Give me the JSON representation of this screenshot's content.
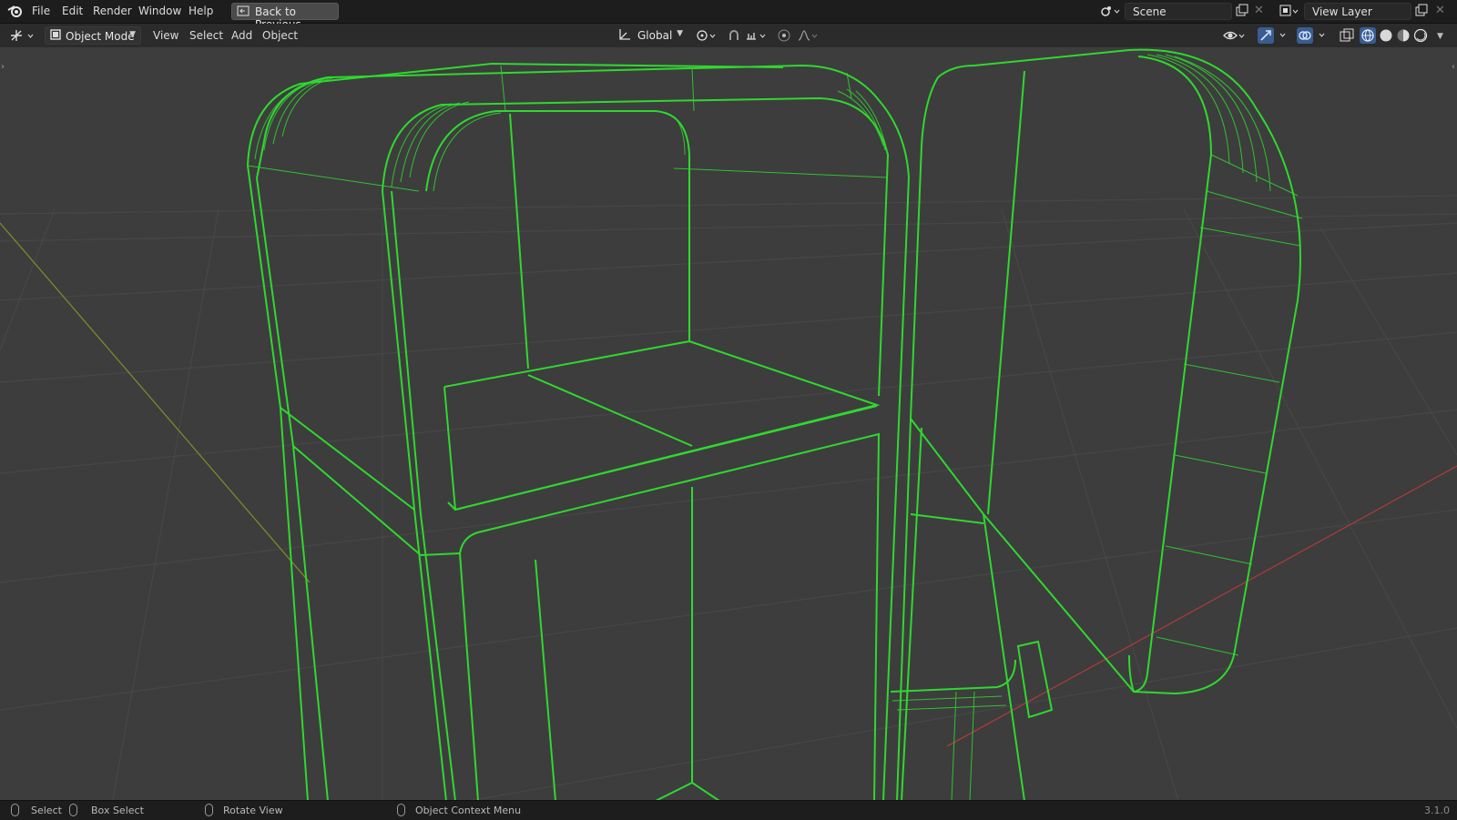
{
  "app": {
    "logo_icon": "blender-logo-icon"
  },
  "menu": [
    "File",
    "Edit",
    "Render",
    "Window",
    "Help"
  ],
  "back_button": {
    "label": "Back to Previous"
  },
  "scene": {
    "label": "Scene"
  },
  "view_layer": {
    "label": "View Layer"
  },
  "header": {
    "mode": "Object Mode",
    "menus": [
      "View",
      "Select",
      "Add",
      "Object"
    ],
    "transform_orientation": "Global"
  },
  "status": {
    "select": "Select",
    "box_select": "Box Select",
    "rotate_view": "Rotate View",
    "context_menu": "Object Context Menu",
    "version": "3.1.0"
  },
  "colors": {
    "wire": "#2fd82f",
    "grid": "#4a4a4a",
    "x_axis": "#a83a3a",
    "y_axis": "#7b8a2a"
  }
}
